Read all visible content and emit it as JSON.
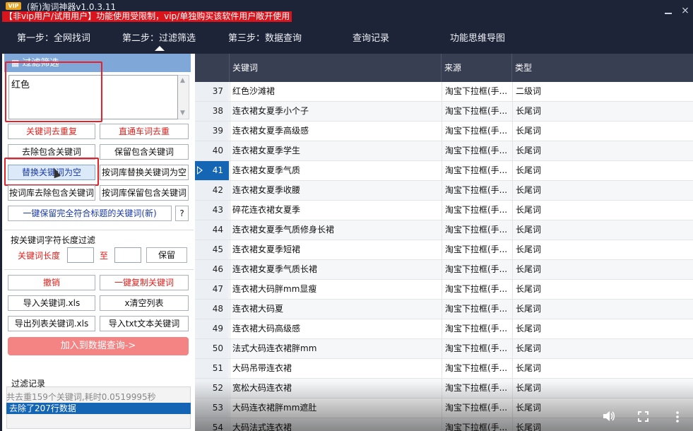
{
  "titlebar": {
    "vip_badge": "VIP",
    "app_title": "(新)淘词神器v1.0.3.11",
    "notice": "【非vip用户/试用用户】功能使用受限制，vip/单独购买该软件用户敞开使用",
    "close_glyph": "⨯"
  },
  "nav": {
    "items": [
      "第一步：全网找词",
      "第二步：过滤筛选",
      "第三步：数据查询",
      "查询记录",
      "功能思维导图"
    ],
    "active_index": 1
  },
  "filter": {
    "header": "过滤筛选",
    "header_icon": "grid-icon",
    "keyword_input_value": "红色"
  },
  "buttons": {
    "dedupe": "关键词去重复",
    "through_train_dedupe": "直通车词去重",
    "remove_containing": "去除包含关键词",
    "keep_containing": "保留包含关键词",
    "replace_empty": "替换关键词为空",
    "lib_replace_empty": "按词库替换关键词为空",
    "lib_remove_containing": "按词库去除包含关键词",
    "lib_keep_containing": "按词库保留包含关键词",
    "keep_title_match": "一键保留完全符合标题的关键词(新)",
    "help": "?"
  },
  "length_filter": {
    "group_label": "按关键词字符长度过滤",
    "label": "关键词长度",
    "to": "至",
    "keep": "保留"
  },
  "actions": {
    "undo": "撤销",
    "copy_keywords": "一键复制关键词",
    "import_xls": "导入关键词.xls",
    "clear_list": "x清空列表",
    "export_xls": "导出列表关键词.xls",
    "import_txt": "导入txt文本关键词",
    "add_to_query": "加入到数据查询->"
  },
  "log": {
    "label": "过滤记录",
    "line1": "共去重159个关键词,耗时0.0519995秒",
    "line2": "去除了207行数据"
  },
  "table": {
    "headers": [
      "关键词",
      "来源",
      "类型"
    ],
    "selected_row": 41,
    "rows": [
      {
        "n": "37",
        "kw": "红色沙滩裙",
        "src": "淘宝下拉框(手...",
        "type": "二级词"
      },
      {
        "n": "38",
        "kw": "连衣裙女夏季小个子",
        "src": "淘宝下拉框(手...",
        "type": "长尾词"
      },
      {
        "n": "39",
        "kw": "连衣裙女夏季高级感",
        "src": "淘宝下拉框(手...",
        "type": "长尾词"
      },
      {
        "n": "40",
        "kw": "连衣裙女夏季学生",
        "src": "淘宝下拉框(手...",
        "type": "长尾词"
      },
      {
        "n": "41",
        "kw": "连衣裙女夏季气质",
        "src": "淘宝下拉框(手...",
        "type": "长尾词"
      },
      {
        "n": "42",
        "kw": "连衣裙女夏季收腰",
        "src": "淘宝下拉框(手...",
        "type": "长尾词"
      },
      {
        "n": "43",
        "kw": "碎花连衣裙女夏季",
        "src": "淘宝下拉框(手...",
        "type": "长尾词"
      },
      {
        "n": "44",
        "kw": "连衣裙女夏季气质修身长裙",
        "src": "淘宝下拉框(手...",
        "type": "长尾词"
      },
      {
        "n": "45",
        "kw": "连衣裙女夏季短裙",
        "src": "淘宝下拉框(手...",
        "type": "长尾词"
      },
      {
        "n": "46",
        "kw": "连衣裙女夏季气质长裙",
        "src": "淘宝下拉框(手...",
        "type": "长尾词"
      },
      {
        "n": "47",
        "kw": "连衣裙大码胖mm显瘦",
        "src": "淘宝下拉框(手...",
        "type": "长尾词"
      },
      {
        "n": "48",
        "kw": "连衣裙大码夏",
        "src": "淘宝下拉框(手...",
        "type": "长尾词"
      },
      {
        "n": "49",
        "kw": "连衣裙大码高级感",
        "src": "淘宝下拉框(手...",
        "type": "长尾词"
      },
      {
        "n": "50",
        "kw": "法式大码连衣裙胖mm",
        "src": "淘宝下拉框(手...",
        "type": "长尾词"
      },
      {
        "n": "51",
        "kw": "大码吊带连衣裙",
        "src": "淘宝下拉框(手...",
        "type": "长尾词"
      },
      {
        "n": "52",
        "kw": "宽松大码连衣裙",
        "src": "淘宝下拉框(手...",
        "type": "长尾词"
      },
      {
        "n": "53",
        "kw": "大码连衣裙胖mm遮肚",
        "src": "淘宝下拉框(手...",
        "type": "长尾词"
      },
      {
        "n": "54",
        "kw": "大码法式连衣裙",
        "src": "淘宝下拉框(手...",
        "type": "长尾词"
      }
    ]
  },
  "video_controls": {
    "volume_icon": "volume-icon",
    "fullscreen_icon": "fullscreen-icon",
    "more_icon": "more-vertical-icon"
  }
}
